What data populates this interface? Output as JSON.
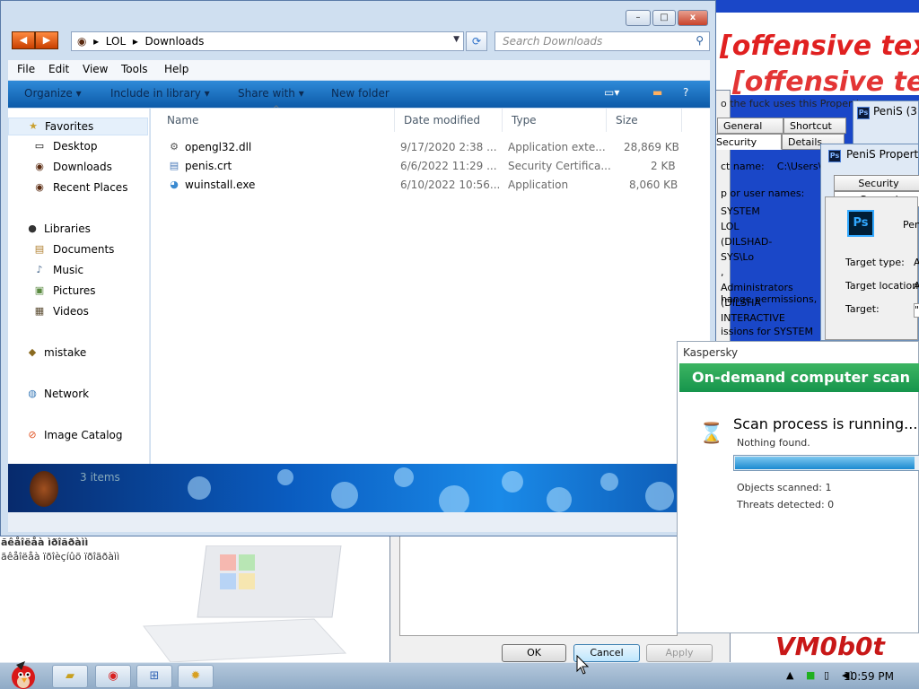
{
  "background": {
    "banner_line1": "[offensive text]",
    "banner_line2": "[offensive text]",
    "bottomleft_line1": "ãêåîëåà ìðîãðàìì",
    "bottomleft_line2": "ãêåîëåà ïðîèçíûõ ïðîãðàìì",
    "vm_text": "VM0b0t"
  },
  "properties_dialog": {
    "hint": "o the fuck uses this Propertie",
    "tabs": [
      "General",
      "Shortcut",
      "Security",
      "Details"
    ],
    "object_name_label": "ct name:",
    "object_name_value": "C:\\Users\\P",
    "group_label": "p or user names:",
    "groups": [
      "SYSTEM",
      "LOL (DILSHAD-SYS\\Lo",
      ", Administrators (DILSHA",
      "INTERACTIVE"
    ],
    "change_perm": "hange permissions, click",
    "perms_for": "issions for SYSTEM",
    "buttons": {
      "ok": "OK",
      "cancel": "Cancel",
      "apply": "Apply"
    }
  },
  "penis_windows": {
    "win1_title": "PeniS (3",
    "win2_title": "PeniS Properti",
    "win2_tabs": [
      "Security",
      "General"
    ],
    "win2_name": "Peni",
    "fields": [
      "Target type:",
      "Target location:",
      "Target:"
    ],
    "field_values": [
      "A",
      "A",
      "\""
    ]
  },
  "explorer": {
    "window_buttons": {
      "min": "–",
      "max": "□",
      "close": "x"
    },
    "breadcrumb": [
      "LOL",
      "Downloads"
    ],
    "search_placeholder": "Search Downloads",
    "menu": [
      "File",
      "Edit",
      "View",
      "Tools",
      "Help"
    ],
    "commands": [
      "Organize ▾",
      "Include in library ▾",
      "Share with ▾",
      "New folder"
    ],
    "nav": {
      "favorites": "Favorites",
      "favorite_items": [
        "Desktop",
        "Downloads",
        "Recent Places"
      ],
      "libraries": "Libraries",
      "library_items": [
        "Documents",
        "Music",
        "Pictures",
        "Videos"
      ],
      "mistake": "mistake",
      "network": "Network",
      "image_catalog": "Image Catalog"
    },
    "columns": [
      "Name",
      "Date modified",
      "Type",
      "Size"
    ],
    "files": [
      {
        "name": "opengl32.dll",
        "date": "9/17/2020 2:38 ...",
        "type": "Application exte...",
        "size": "28,869 KB",
        "icon": "dll-icon"
      },
      {
        "name": "penis.crt",
        "date": "6/6/2022 11:29 ...",
        "type": "Security Certifica...",
        "size": "2 KB",
        "icon": "certificate-icon"
      },
      {
        "name": "wuinstall.exe",
        "date": "6/10/2022 10:56...",
        "type": "Application",
        "size": "8,060 KB",
        "icon": "exe-icon"
      }
    ],
    "item_count": "3 items"
  },
  "kaspersky": {
    "title": "Kaspersky",
    "banner": "On-demand computer scan",
    "status": "Scan process is running...",
    "found": "Nothing found.",
    "progress": 0.97,
    "objects_scanned": "Objects scanned: 1",
    "threats_detected": "Threats detected: 0"
  },
  "taskbar": {
    "clock": "10:59 PM",
    "apps": [
      "explorer-icon",
      "chrome-icon",
      "network-tool-icon",
      "settings-icon"
    ]
  },
  "colors": {
    "accent": "#1a47c8",
    "kaspersky_green": "#16954c",
    "banner_red": "#e02020"
  }
}
